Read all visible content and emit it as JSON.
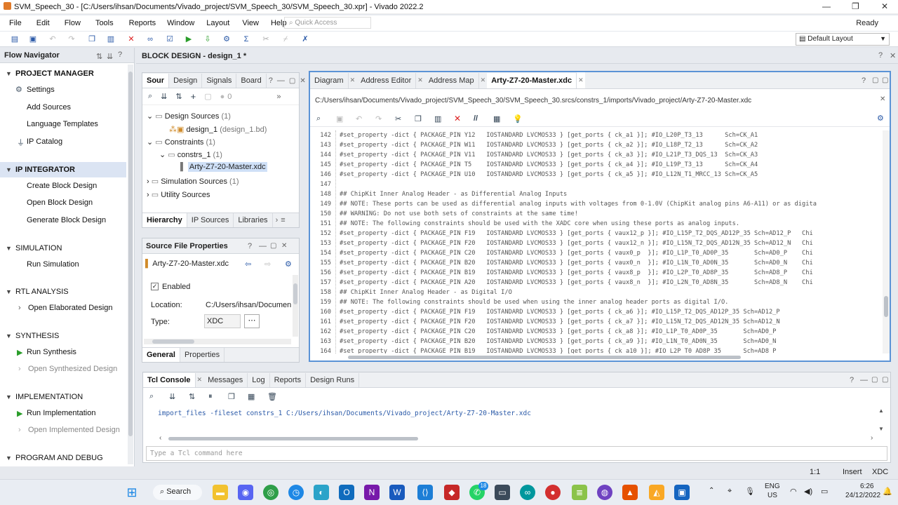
{
  "window": {
    "title": "SVM_Speech_30 - [C:/Users/ihsan/Documents/Vivado_project/SVM_Speech_30/SVM_Speech_30.xpr] - Vivado 2022.2",
    "minimize": "—",
    "maximize": "❐",
    "close": "✕"
  },
  "menu": {
    "items": [
      "File",
      "Edit",
      "Flow",
      "Tools",
      "Reports",
      "Window",
      "Layout",
      "View",
      "Help"
    ],
    "quick_access_placeholder": "Quick Access",
    "status": "Ready"
  },
  "toolbar": {
    "layout_select": "Default Layout"
  },
  "flow_navigator": {
    "title": "Flow Navigator",
    "sections": [
      {
        "label": "PROJECT MANAGER",
        "items": [
          {
            "label": "Settings",
            "icon": "gear-icon"
          },
          {
            "label": "Add Sources"
          },
          {
            "label": "Language Templates"
          },
          {
            "label": "IP Catalog",
            "icon": "plug-icon"
          }
        ]
      },
      {
        "label": "IP INTEGRATOR",
        "items": [
          {
            "label": "Create Block Design"
          },
          {
            "label": "Open Block Design"
          },
          {
            "label": "Generate Block Design"
          }
        ]
      },
      {
        "label": "SIMULATION",
        "items": [
          {
            "label": "Run Simulation"
          }
        ]
      },
      {
        "label": "RTL ANALYSIS",
        "items": [
          {
            "label": "Open Elaborated Design"
          }
        ]
      },
      {
        "label": "SYNTHESIS",
        "items": [
          {
            "label": "Run Synthesis",
            "icon": "play-icon"
          },
          {
            "label": "Open Synthesized Design",
            "disabled": true
          }
        ]
      },
      {
        "label": "IMPLEMENTATION",
        "items": [
          {
            "label": "Run Implementation",
            "icon": "play-icon"
          },
          {
            "label": "Open Implemented Design",
            "disabled": true
          }
        ]
      },
      {
        "label": "PROGRAM AND DEBUG",
        "items": []
      }
    ]
  },
  "block_design": {
    "title": "BLOCK DESIGN - design_1 *"
  },
  "sources": {
    "tabs": [
      "Sour",
      "Design",
      "Signals",
      "Board"
    ],
    "count": "0",
    "tree": [
      {
        "label": "Design Sources",
        "count": "(1)"
      },
      {
        "label": "design_1",
        "count": "(design_1.bd)"
      },
      {
        "label": "Constraints",
        "count": "(1)"
      },
      {
        "label": "constrs_1",
        "count": "(1)"
      },
      {
        "label": "Arty-Z7-20-Master.xdc",
        "count": ""
      },
      {
        "label": "Simulation Sources",
        "count": "(1)"
      },
      {
        "label": "Utility Sources",
        "count": ""
      }
    ],
    "bottom_tabs": [
      "Hierarchy",
      "IP Sources",
      "Libraries"
    ]
  },
  "source_props": {
    "title": "Source File Properties",
    "file": "Arty-Z7-20-Master.xdc",
    "enabled_label": "Enabled",
    "location_label": "Location:",
    "location_value": "C:/Users/ihsan/Documents/",
    "type_label": "Type:",
    "type_value": "XDC",
    "tabs": [
      "General",
      "Properties"
    ]
  },
  "editor": {
    "tabs": [
      "Diagram",
      "Address Editor",
      "Address Map",
      "Arty-Z7-20-Master.xdc"
    ],
    "path": "C:/Users/ihsan/Documents/Vivado_project/SVM_Speech_30/SVM_Speech_30.srcs/constrs_1/imports/Vivado_project/Arty-Z7-20-Master.xdc",
    "lines": [
      {
        "n": "142",
        "t": "#set_property -dict { PACKAGE_PIN Y12   IOSTANDARD LVCMOS33 } [get_ports { ck_a1 }]; #IO_L20P_T3_13      Sch=CK_A1"
      },
      {
        "n": "143",
        "t": "#set_property -dict { PACKAGE_PIN W11   IOSTANDARD LVCMOS33 } [get_ports { ck_a2 }]; #IO_L18P_T2_13      Sch=CK_A2"
      },
      {
        "n": "144",
        "t": "#set_property -dict { PACKAGE_PIN V11   IOSTANDARD LVCMOS33 } [get_ports { ck_a3 }]; #IO_L21P_T3_DQS_13  Sch=CK_A3"
      },
      {
        "n": "145",
        "t": "#set_property -dict { PACKAGE_PIN T5    IOSTANDARD LVCMOS33 } [get_ports { ck_a4 }]; #IO_L19P_T3_13      Sch=CK_A4"
      },
      {
        "n": "146",
        "t": "#set_property -dict { PACKAGE_PIN U10   IOSTANDARD LVCMOS33 } [get_ports { ck_a5 }]; #IO_L12N_T1_MRCC_13 Sch=CK_A5"
      },
      {
        "n": "147",
        "t": ""
      },
      {
        "n": "148",
        "t": "## ChipKit Inner Analog Header - as Differential Analog Inputs"
      },
      {
        "n": "149",
        "t": "## NOTE: These ports can be used as differential analog inputs with voltages from 0-1.0V (ChipKit analog pins A6-A11) or as digita"
      },
      {
        "n": "150",
        "t": "## WARNING: Do not use both sets of constraints at the same time!"
      },
      {
        "n": "151",
        "t": "## NOTE: The following constraints should be used with the XADC core when using these ports as analog inputs."
      },
      {
        "n": "152",
        "t": "#set_property -dict { PACKAGE_PIN F19   IOSTANDARD LVCMOS33 } [get_ports { vaux12_p }]; #IO_L15P_T2_DQS_AD12P_35 Sch=AD12_P   Chi"
      },
      {
        "n": "153",
        "t": "#set_property -dict { PACKAGE_PIN F20   IOSTANDARD LVCMOS33 } [get_ports { vaux12_n }]; #IO_L15N_T2_DQS_AD12N_35 Sch=AD12_N   Chi"
      },
      {
        "n": "154",
        "t": "#set_property -dict { PACKAGE_PIN C20   IOSTANDARD LVCMOS33 } [get_ports { vaux0_p  }]; #IO_L1P_T0_AD0P_35       Sch=AD0_P    Chi"
      },
      {
        "n": "155",
        "t": "#set_property -dict { PACKAGE_PIN B20   IOSTANDARD LVCMOS33 } [get_ports { vaux0_n  }]; #IO_L1N_T0_AD0N_35       Sch=AD0_N    Chi"
      },
      {
        "n": "156",
        "t": "#set_property -dict { PACKAGE_PIN B19   IOSTANDARD LVCMOS33 } [get_ports { vaux8_p  }]; #IO_L2P_T0_AD8P_35       Sch=AD8_P    Chi"
      },
      {
        "n": "157",
        "t": "#set_property -dict { PACKAGE_PIN A20   IOSTANDARD LVCMOS33 } [get_ports { vaux8_n  }]; #IO_L2N_T0_AD8N_35       Sch=AD8_N    Chi"
      },
      {
        "n": "158",
        "t": "## ChipKit Inner Analog Header - as Digital I/O"
      },
      {
        "n": "159",
        "t": "## NOTE: The following constraints should be used when using the inner analog header ports as digital I/O."
      },
      {
        "n": "160",
        "t": "#set_property -dict { PACKAGE_PIN F19   IOSTANDARD LVCMOS33 } [get_ports { ck_a6 }]; #IO_L15P_T2_DQS_AD12P_35 Sch=AD12_P"
      },
      {
        "n": "161",
        "t": "#set_property -dict { PACKAGE_PIN F20   IOSTANDARD LVCMOS33 } [get_ports { ck_a7 }]; #IO_L15N_T2_DQS_AD12N_35 Sch=AD12_N"
      },
      {
        "n": "162",
        "t": "#set_property -dict { PACKAGE_PIN C20   IOSTANDARD LVCMOS33 } [get_ports { ck_a8 }]; #IO_L1P_T0_AD0P_35       Sch=AD0_P"
      },
      {
        "n": "163",
        "t": "#set_property -dict { PACKAGE_PIN B20   IOSTANDARD LVCMOS33 } [get_ports { ck_a9 }]; #IO_L1N_T0_AD0N_35       Sch=AD0_N"
      },
      {
        "n": "164",
        "t": "#set_property -dict { PACKAGE_PIN B19   IOSTANDARD LVCMOS33 } [get_ports { ck_a10 }]; #IO_L2P_T0_AD8P_35      Sch=AD8_P"
      }
    ]
  },
  "tcl": {
    "tabs": [
      "Tcl Console",
      "Messages",
      "Log",
      "Reports",
      "Design Runs"
    ],
    "output": "import_files -fileset constrs_1 C:/Users/ihsan/Documents/Vivado_project/Arty-Z7-20-Master.xdc",
    "placeholder": "Type a Tcl command here"
  },
  "statusbar": {
    "pos": "1:1",
    "mode": "Insert",
    "type": "XDC"
  },
  "taskbar": {
    "search": "Search",
    "lang": "ENG",
    "region": "US",
    "time": "6:26",
    "date": "24/12/2022",
    "badge": "18"
  },
  "colors": {
    "accent": "#5b93d6",
    "selection": "#dbe4f3",
    "code": "#555555"
  }
}
